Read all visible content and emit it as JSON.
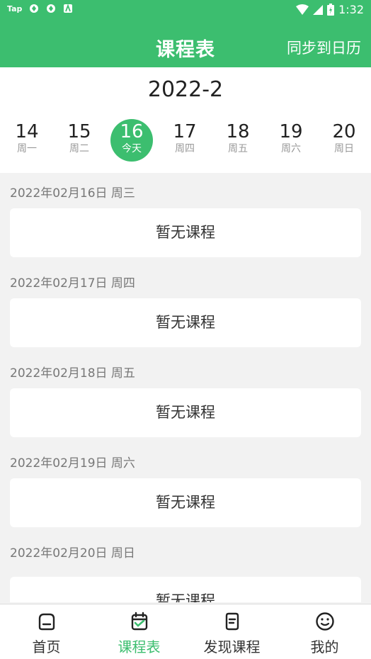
{
  "status_bar": {
    "app_name": "Tap",
    "time": "1:32",
    "accent_color": "#3cbe6f"
  },
  "header": {
    "title": "课程表",
    "action_label": "同步到日历"
  },
  "week": {
    "month": "2022-2",
    "days": [
      {
        "num": "14",
        "label": "周一"
      },
      {
        "num": "15",
        "label": "周二"
      },
      {
        "num": "16",
        "label": "今天",
        "active": true
      },
      {
        "num": "17",
        "label": "周四"
      },
      {
        "num": "18",
        "label": "周五"
      },
      {
        "num": "19",
        "label": "周六"
      },
      {
        "num": "20",
        "label": "周日"
      }
    ]
  },
  "schedule": [
    {
      "date": "2022年02月16日 周三",
      "empty_text": "暂无课程"
    },
    {
      "date": "2022年02月17日 周四",
      "empty_text": "暂无课程"
    },
    {
      "date": "2022年02月18日 周五",
      "empty_text": "暂无课程"
    },
    {
      "date": "2022年02月19日 周六",
      "empty_text": "暂无课程"
    },
    {
      "date": "2022年02月20日 周日",
      "empty_text": "暂无课程"
    }
  ],
  "bottom_nav": [
    {
      "label": "首页",
      "icon": "home-icon"
    },
    {
      "label": "课程表",
      "icon": "calendar-icon",
      "active": true
    },
    {
      "label": "发现课程",
      "icon": "document-icon"
    },
    {
      "label": "我的",
      "icon": "smiley-icon"
    }
  ]
}
